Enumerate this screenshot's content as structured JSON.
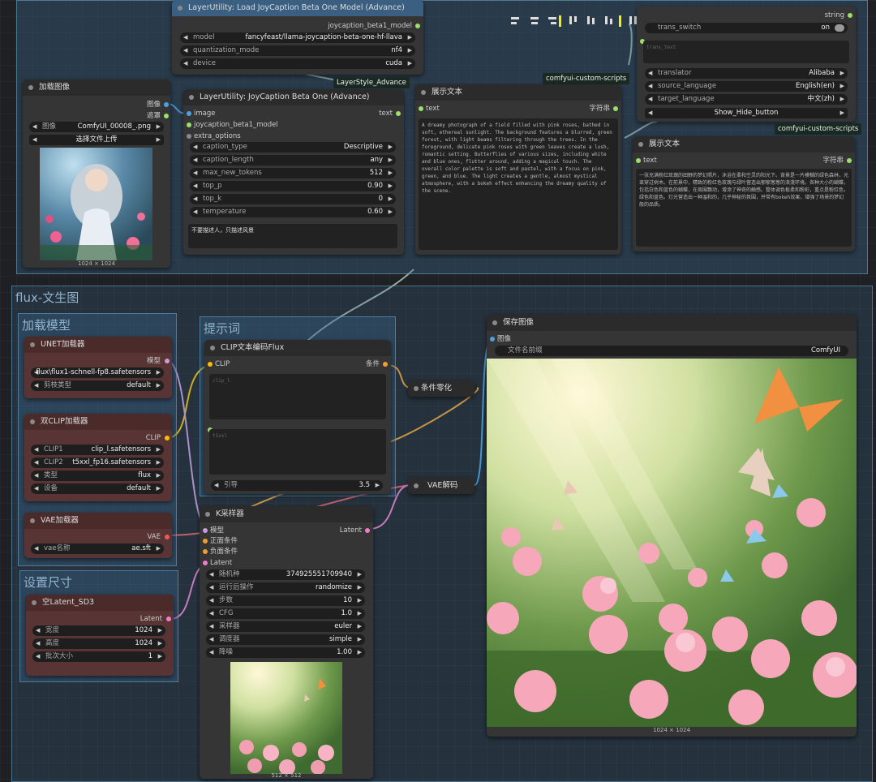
{
  "colors": {
    "group": "#3c6e96",
    "node": "#353535",
    "node_red": "#593434",
    "clip_yellow": "#f6c000",
    "model_lilac": "#c89bdc",
    "vae_red": "#e85c5c",
    "image_blue": "#4aa3e0",
    "latent_pink": "#f07ccc",
    "cond_orange": "#f0a030",
    "string_green": "#9ce06c"
  },
  "top": {
    "load_model": {
      "title": "LayerUtility: Load JoyCaption Beta One Model (Advance)",
      "out": "joycaption_beta1_model",
      "w": [
        {
          "l": "model",
          "v": "fancyfeast/llama-joycaption-beta-one-hf-llava"
        },
        {
          "l": "quantization_mode",
          "v": "nf4"
        },
        {
          "l": "device",
          "v": "cuda"
        }
      ]
    },
    "badge_layerstyle": "LayerStyle_Advance",
    "badge_ccs1": "comfyui-custom-scripts",
    "badge_ccs2": "comfyui-custom-scripts",
    "load_image": {
      "title": "加载图像",
      "out1": "图像",
      "out2": "遮罩",
      "file_label": "图像",
      "file_value": "ComfyUI_00008_.png",
      "upload": "选择文件上传",
      "size": "1024 × 1024"
    },
    "joycaption": {
      "title": "LayerUtility: JoyCaption Beta One (Advance)",
      "in1": "image",
      "in2": "joycaption_beta1_model",
      "in3": "extra_options",
      "out": "text",
      "w": [
        {
          "l": "caption_type",
          "v": "Descriptive"
        },
        {
          "l": "caption_length",
          "v": "any"
        },
        {
          "l": "max_new_tokens",
          "v": "512"
        },
        {
          "l": "top_p",
          "v": "0.90"
        },
        {
          "l": "top_k",
          "v": "0"
        },
        {
          "l": "temperature",
          "v": "0.60"
        }
      ],
      "prompt": "不要描述人，只描述风景"
    },
    "show1": {
      "title": "展示文本",
      "in": "text",
      "out": "字符串",
      "text": "A dreamy photograph of a field filled with pink roses, bathed in soft, ethereal sunlight. The background features a blurred, green forest, with light beams filtering through the trees. In the foreground, delicate pink roses with green leaves create a lush, romantic setting. Butterflies of various sizes, including white and blue ones, flutter around, adding a magical touch. The overall color palette is soft and pastel, with a focus on pink, green, and blue. The light creates a gentle, almost mystical atmosphere, with a bokeh effect enhancing the dreamy quality of the scene."
    },
    "translate": {
      "out": "string",
      "switch_label": "trans_switch",
      "switch_value": "on",
      "text_placeholder": "trans_text",
      "w": [
        {
          "l": "translator",
          "v": "Alibaba"
        },
        {
          "l": "source_language",
          "v": "English(en)"
        },
        {
          "l": "target_language",
          "v": "中文(zh)"
        }
      ],
      "button": "Show_Hide_button"
    },
    "show2": {
      "title": "展示文本",
      "in": "text",
      "out": "字符串",
      "text": "一张充满粉红玫瑰的田野的梦幻照片，沐浴在柔和空灵的阳光下。背景是一片模糊的绿色森林，光束穿过树木。在前景中，精致的粉红色玫瑰与绿叶营造出郁郁葱葱的浪漫环境。各种大小的蝴蝶，包括白色和蓝色的蝴蝶，在周围飘动，增添了神奇的触感。整体调色板柔和粉彩，重点是粉红色，绿色和蓝色。灯光营造出一种温和的，几乎神秘的氛围，并带有bokeh效果，增强了场景的梦幻般的品质。"
    }
  },
  "groups": {
    "flux": "flux-文生图",
    "load": "加载模型",
    "prompt": "提示词",
    "size": "设置尺寸"
  },
  "unet": {
    "title": "UNET加载器",
    "out": "模型",
    "w": [
      {
        "l": "",
        "v": "flux\\flux1-schnell-fp8.safetensors"
      },
      {
        "l": "剪枝类型",
        "v": "default"
      }
    ]
  },
  "dualclip": {
    "title": "双CLIP加载器",
    "out": "CLIP",
    "w": [
      {
        "l": "CLIP1",
        "v": "clip_l.safetensors"
      },
      {
        "l": "CLIP2",
        "v": "t5xxl_fp16.safetensors"
      },
      {
        "l": "类型",
        "v": "flux"
      },
      {
        "l": "设备",
        "v": "default"
      }
    ]
  },
  "vaeloader": {
    "title": "VAE加载器",
    "out": "VAE",
    "w": [
      {
        "l": "vae名称",
        "v": "ae.sft"
      }
    ]
  },
  "latent": {
    "title": "空Latent_SD3",
    "out": "Latent",
    "w": [
      {
        "l": "宽度",
        "v": "1024"
      },
      {
        "l": "高度",
        "v": "1024"
      },
      {
        "l": "批次大小",
        "v": "1"
      }
    ]
  },
  "clipenc": {
    "title": "CLIP文本编码Flux",
    "in": "CLIP",
    "out": "条件",
    "ph1": "clip_l",
    "ph2": "t5xxl",
    "guidance_l": "引导",
    "guidance_v": "3.5"
  },
  "zero": {
    "title": "条件零化"
  },
  "vaedecode": {
    "title": "VAE解码"
  },
  "ksampler": {
    "title": "K采样器",
    "in": [
      "模型",
      "正面条件",
      "负面条件",
      "Latent"
    ],
    "out": "Latent",
    "w": [
      {
        "l": "随机种",
        "v": "374925551709940"
      },
      {
        "l": "运行后操作",
        "v": "randomize"
      },
      {
        "l": "步数",
        "v": "10"
      },
      {
        "l": "CFG",
        "v": "1.0"
      },
      {
        "l": "采样器",
        "v": "euler"
      },
      {
        "l": "调度器",
        "v": "simple"
      },
      {
        "l": "降噪",
        "v": "1.00"
      }
    ],
    "size": "512 × 512"
  },
  "save": {
    "title": "保存图像",
    "in": "图像",
    "prefix_l": "文件名前缀",
    "prefix_v": "ComfyUI",
    "size": "1024 × 1024"
  }
}
